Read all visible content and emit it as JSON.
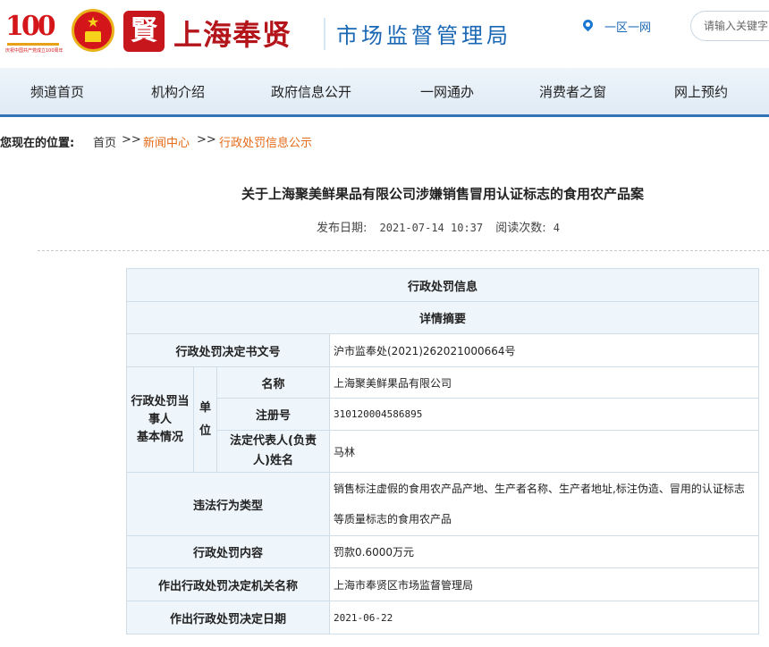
{
  "header": {
    "anniv_number": "100",
    "anniv_caption": "庆祝中国共产党成立100周年",
    "seal_char": "賢",
    "site_title": "上海奉贤",
    "site_subtitle": "市场监督管理局",
    "yiqu_label": "一区一网",
    "search_placeholder": "请输入关键字"
  },
  "nav": [
    "频道首页",
    "机构介绍",
    "政府信息公开",
    "一网通办",
    "消费者之窗",
    "网上预约"
  ],
  "breadcrumb": {
    "prefix": "您现在的位置:",
    "items": [
      "首页",
      "新闻中心",
      "行政处罚信息公示"
    ],
    "separator": ">>"
  },
  "article": {
    "title": "关于上海聚美鲜果品有限公司涉嫌销售冒用认证标志的食用农产品案",
    "publish_label": "发布日期:",
    "publish_date": "2021-07-14 10:37",
    "views_label": "阅读次数:",
    "views": "4"
  },
  "table": {
    "section_title": "行政处罚信息",
    "summary_title": "详情摘要",
    "doc_no_label": "行政处罚决定书文号",
    "doc_no_value": "沪市监奉处(2021)262021000664号",
    "party_group_label": [
      "行政处罚当",
      "事人",
      "基本情况"
    ],
    "unit_label": [
      "单",
      "位"
    ],
    "name_label": "名称",
    "name_value": "上海聚美鲜果品有限公司",
    "reg_label": "注册号",
    "reg_value": "310120004586895",
    "rep_label": [
      "法定代表人(负责",
      "人)姓名"
    ],
    "rep_value": "马林",
    "violation_label": "违法行为类型",
    "violation_value": [
      "销售标注虚假的食用农产品产地、生产者名称、生产者地址,标注伪造、冒用的认证标志",
      "等质量标志的食用农产品"
    ],
    "penalty_label": "行政处罚内容",
    "penalty_value": "罚款0.6000万元",
    "org_label": "作出行政处罚决定机关名称",
    "org_value": "上海市奉贤区市场监督管理局",
    "date_label": "作出行政处罚决定日期",
    "date_value": "2021-06-22"
  },
  "colors": {
    "brand_red": "#b4151b",
    "brand_blue": "#1a67b4",
    "link_orange": "#e46a17",
    "nav_border": "#2f72b5",
    "table_label_bg": "#eef5fb"
  }
}
